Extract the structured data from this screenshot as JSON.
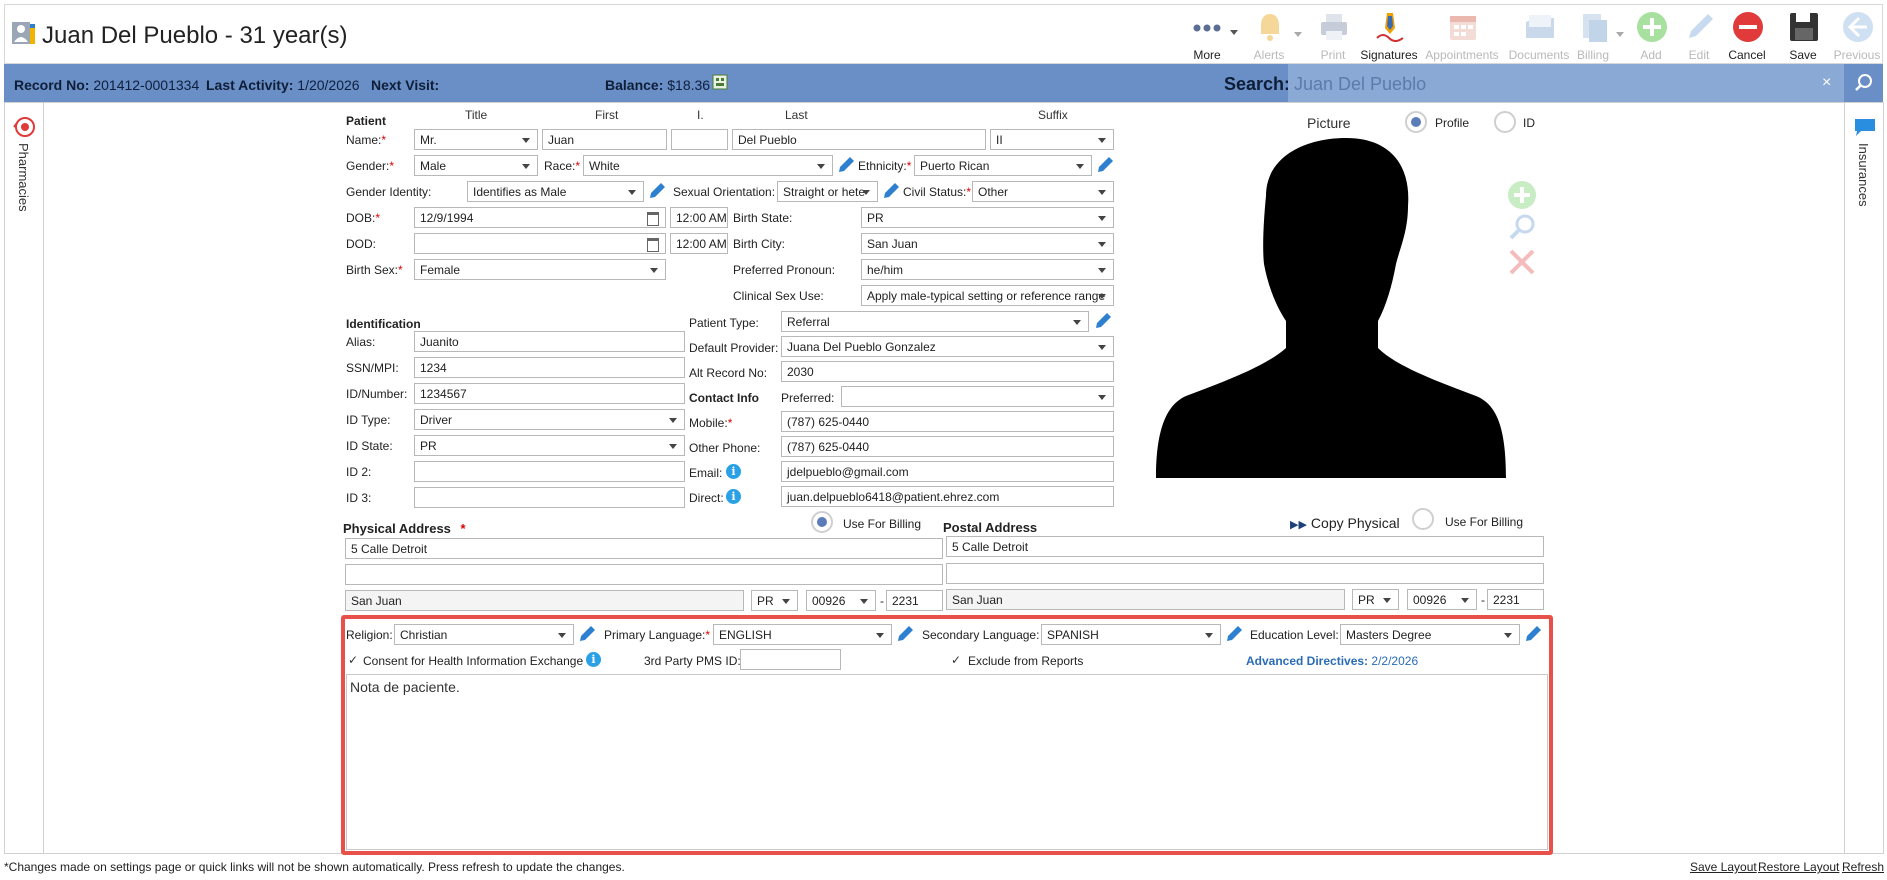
{
  "app": {
    "title": "Juan Del Pueblo - 31 year(s)"
  },
  "toolbar": [
    {
      "label": "More",
      "icon": "more-icon",
      "enabled": true
    },
    {
      "label": "Alerts",
      "icon": "bell-icon",
      "enabled": false
    },
    {
      "label": "Print",
      "icon": "printer-icon",
      "enabled": false
    },
    {
      "label": "Signatures",
      "icon": "pen-signature-icon",
      "enabled": true
    },
    {
      "label": "Appointments",
      "icon": "calendar-icon",
      "enabled": false
    },
    {
      "label": "Documents",
      "icon": "documents-icon",
      "enabled": false
    },
    {
      "label": "Billing",
      "icon": "billing-icon",
      "enabled": false
    },
    {
      "label": "Add",
      "icon": "plus-circle-icon",
      "enabled": false
    },
    {
      "label": "Edit",
      "icon": "pencil-icon",
      "enabled": false
    },
    {
      "label": "Cancel",
      "icon": "cancel-circle-icon",
      "enabled": true
    },
    {
      "label": "Save",
      "icon": "floppy-disk-icon",
      "enabled": true
    },
    {
      "label": "Previous",
      "icon": "arrow-left-circle-icon",
      "enabled": false
    }
  ],
  "infobar": {
    "record_label": "Record No:",
    "record_value": "201412-0001334",
    "activity_label": "Last Activity:",
    "activity_value": "1/20/2026",
    "next_visit_label": "Next Visit:",
    "balance_label": "Balance:",
    "balance_value": "$18.36",
    "search_label": "Search:",
    "search_value": "Juan Del Pueblo",
    "clear": "×"
  },
  "side": {
    "left_label": "Pharmacies",
    "right_label": "Insurances"
  },
  "patient": {
    "section": "Patient",
    "col_title": "Title",
    "col_first": "First",
    "col_initial": "I.",
    "col_last": "Last",
    "col_suffix": "Suffix",
    "name_label": "Name:",
    "title": "Mr.",
    "first": "Juan",
    "initial": "",
    "last": "Del Pueblo",
    "suffix": "II",
    "gender_label": "Gender:",
    "gender": "Male",
    "race_label": "Race:",
    "race": "White",
    "ethnicity_label": "Ethnicity:",
    "ethnicity": "Puerto Rican",
    "gender_identity_label": "Gender Identity:",
    "gender_identity": "Identifies as Male",
    "orientation_label": "Sexual Orientation:",
    "orientation": "Straight or hete",
    "civil_label": "Civil Status:",
    "civil": "Other",
    "dob_label": "DOB:",
    "dob": "12/9/1994",
    "dob_time": "12:00 AM",
    "birth_state_label": "Birth State:",
    "birth_state": "PR",
    "dod_label": "DOD:",
    "dod": "",
    "dod_time": "12:00 AM",
    "birth_city_label": "Birth City:",
    "birth_city": "San Juan",
    "birth_sex_label": "Birth Sex:",
    "birth_sex": "Female",
    "pronoun_label": "Preferred Pronoun:",
    "pronoun": "he/him",
    "clinical_label": "Clinical Sex Use:",
    "clinical": "Apply male-typical setting or reference range"
  },
  "identification": {
    "section": "Identification",
    "alias_label": "Alias:",
    "alias": "Juanito",
    "ssn_label": "SSN/MPI:",
    "ssn": "1234",
    "idnum_label": "ID/Number:",
    "idnum": "1234567",
    "idtype_label": "ID Type:",
    "idtype": "Driver",
    "idstate_label": "ID State:",
    "idstate": "PR",
    "id2_label": "ID 2:",
    "id2": "",
    "id3_label": "ID 3:",
    "id3": "",
    "ptype_label": "Patient Type:",
    "ptype": "Referral",
    "provider_label": "Default Provider:",
    "provider": "Juana Del Pueblo Gonzalez",
    "alt_label": "Alt Record No:",
    "alt": "2030"
  },
  "contact": {
    "section": "Contact Info",
    "preferred_label": "Preferred:",
    "preferred": "",
    "mobile_label": "Mobile:",
    "mobile": "(787) 625-0440",
    "other_label": "Other Phone:",
    "other": "(787) 625-0440",
    "email_label": "Email:",
    "email": "jdelpueblo@gmail.com",
    "direct_label": "Direct:",
    "direct": "juan.delpueblo6418@patient.ehrez.com"
  },
  "picture": {
    "label": "Picture",
    "profile_label": "Profile",
    "id_label": "ID"
  },
  "physical": {
    "label": "Physical Address",
    "use_billing": "Use For Billing",
    "line1": "5 Calle Detroit",
    "line2": "",
    "city": "San Juan",
    "state": "PR",
    "zip": "00926",
    "zip4": "2231",
    "dash": "-"
  },
  "postal": {
    "label": "Postal Address",
    "copy": "Copy Physical",
    "use_billing": "Use For Billing",
    "line1": "5 Calle Detroit",
    "line2": "",
    "city": "San Juan",
    "state": "PR",
    "zip": "00926",
    "zip4": "2231",
    "dash": "-"
  },
  "extra": {
    "religion_label": "Religion:",
    "religion": "Christian",
    "primary_label": "Primary Language:",
    "primary": "ENGLISH",
    "secondary_label": "Secondary Language:",
    "secondary": "SPANISH",
    "education_label": "Education Level:",
    "education": "Masters Degree",
    "consent_label": "Consent for Health Information Exchange",
    "pms_label": "3rd Party PMS ID:",
    "pms": "",
    "exclude_label": "Exclude from Reports",
    "adv_label": "Advanced Directives:",
    "adv_date": "2/2/2026",
    "note": "Nota de paciente."
  },
  "footer": {
    "note": "*Changes made on settings page or quick links will not be shown automatically. Press refresh to update the changes.",
    "save_layout": "Save Layout",
    "restore_layout": "Restore Layout",
    "refresh": "Refresh"
  }
}
